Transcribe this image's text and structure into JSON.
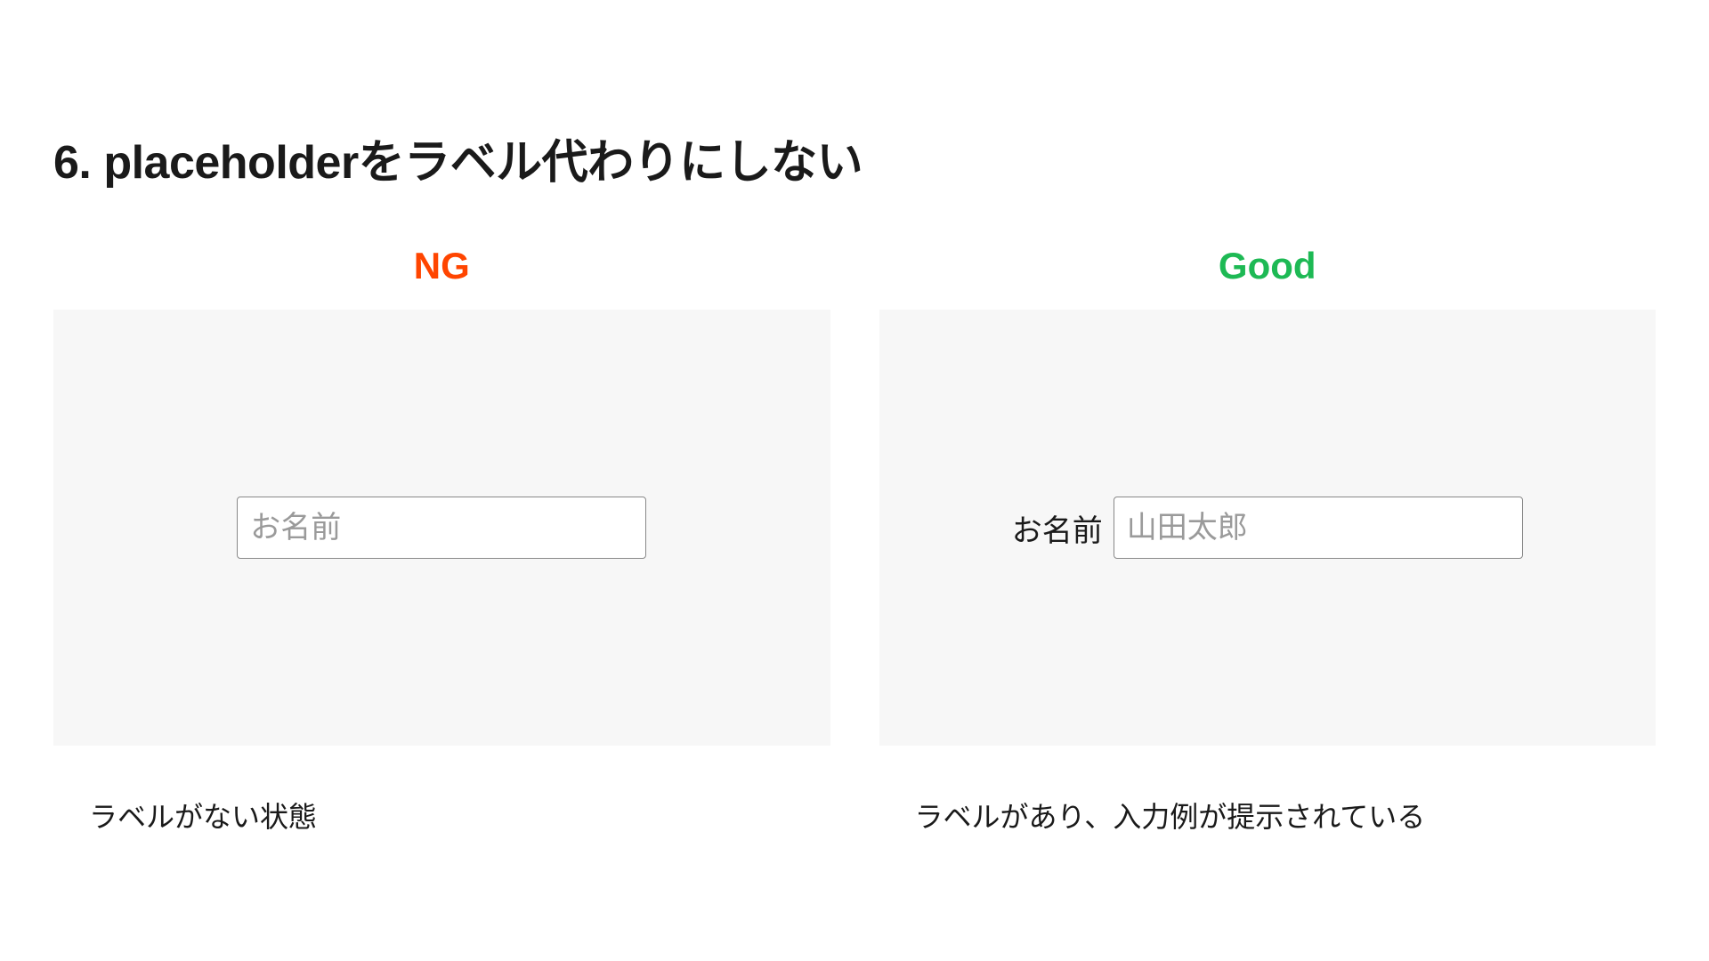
{
  "title": "6. placeholderをラベル代わりにしない",
  "panels": {
    "ng": {
      "label": "NG",
      "input_placeholder": "お名前",
      "caption": "ラベルがない状態"
    },
    "good": {
      "label": "Good",
      "field_label": "お名前",
      "input_placeholder": "山田太郎",
      "caption": "ラベルがあり、入力例が提示されている"
    }
  }
}
